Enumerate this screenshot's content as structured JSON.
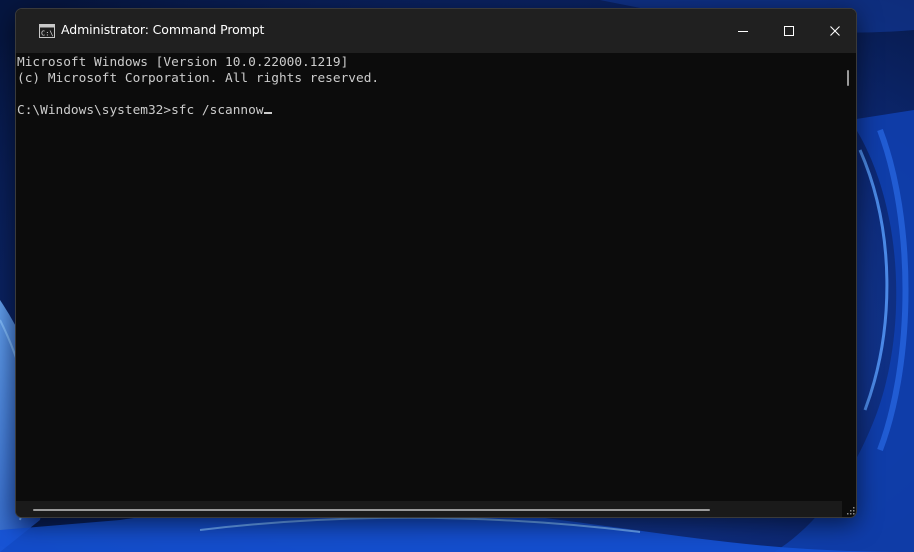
{
  "window": {
    "title": "Administrator: Command Prompt",
    "icons": {
      "app": "command-prompt-icon",
      "minimize": "minimize-icon",
      "maximize": "maximize-icon",
      "close": "close-icon"
    }
  },
  "console": {
    "lines": [
      "Microsoft Windows [Version 10.0.22000.1219]",
      "(c) Microsoft Corporation. All rights reserved.",
      ""
    ],
    "prompt": "C:\\Windows\\system32>",
    "command": "sfc /scannow"
  },
  "colors": {
    "console_background": "#0c0c0c",
    "console_text": "#cccccc",
    "titlebar": "#202020",
    "wallpaper_accent": "#1a5fe0"
  }
}
